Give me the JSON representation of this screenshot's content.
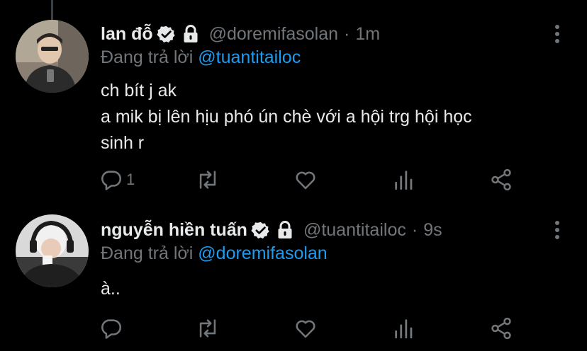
{
  "tweets": [
    {
      "name": "lan đỗ",
      "handle": "@doremifasolan",
      "time": "1m",
      "replying_prefix": "Đang trả lời",
      "replying_to": "@tuantitailoc",
      "lines": [
        "ch bít j ak",
        "a mik bị lên hịu phó ún chè với a hội trg hội học",
        "sinh r"
      ],
      "reply_count": "1",
      "avatar_icon": "person-avatar"
    },
    {
      "name": "nguyễn hiền tuấn",
      "handle": "@tuantitailoc",
      "time": "9s",
      "replying_prefix": "Đang trả lời",
      "replying_to": "@doremifasolan",
      "lines": [
        "à.."
      ],
      "reply_count": "",
      "avatar_icon": "person-avatar"
    }
  ],
  "separator": "·",
  "colors": {
    "background": "#000000",
    "text": "#e7e9ea",
    "muted": "#71767b",
    "link": "#1d9bf0",
    "icon": "#71767b"
  }
}
